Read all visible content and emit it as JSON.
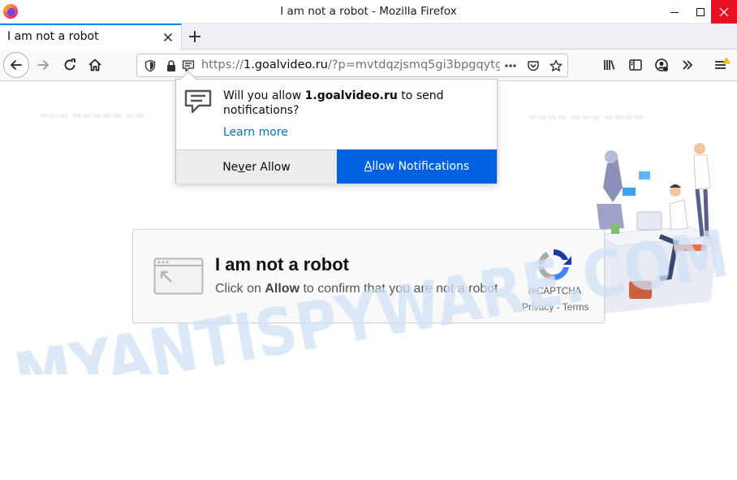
{
  "window": {
    "title": "I am not a robot - Mozilla Firefox",
    "accent_color": "#0a84ff",
    "close_button_color": "#e81123"
  },
  "tab": {
    "title": "I am not a robot"
  },
  "urlbar": {
    "scheme": "https://",
    "host": "1.goalvideo.ru",
    "path": "/?p=mvtdqzjsmq5gi3bpgqytg"
  },
  "notification": {
    "message_prefix": "Will you allow ",
    "message_host": "1.goalvideo.ru",
    "message_suffix": " to send notifications?",
    "learn_more": "Learn more",
    "never_allow_pre": "Ne",
    "never_allow_key": "v",
    "never_allow_post": "er Allow",
    "allow_key": "A",
    "allow_rest": "llow Notifications",
    "allow_color": "#0061e0"
  },
  "captcha": {
    "heading": "I am not a robot",
    "sub_pre": "Click on ",
    "sub_bold": "Allow",
    "sub_post": " to confirm that you are not a robot",
    "brand": "reCAPTCHA",
    "links": "Privacy - Terms"
  },
  "watermark": {
    "text": "MYANTISPYWARE.COM",
    "color": "#cfe0f5"
  },
  "icons": [
    "firefox-logo",
    "minimize-icon",
    "maximize-icon",
    "close-icon",
    "tab-close-icon",
    "new-tab-icon",
    "back-icon",
    "forward-icon",
    "reload-icon",
    "home-icon",
    "tracking-shield-icon",
    "lock-icon",
    "notification-permission-icon",
    "page-actions-icon",
    "pocket-icon",
    "bookmark-star-icon",
    "library-icon",
    "sidebar-icon",
    "account-icon",
    "overflow-icon",
    "menu-icon"
  ]
}
